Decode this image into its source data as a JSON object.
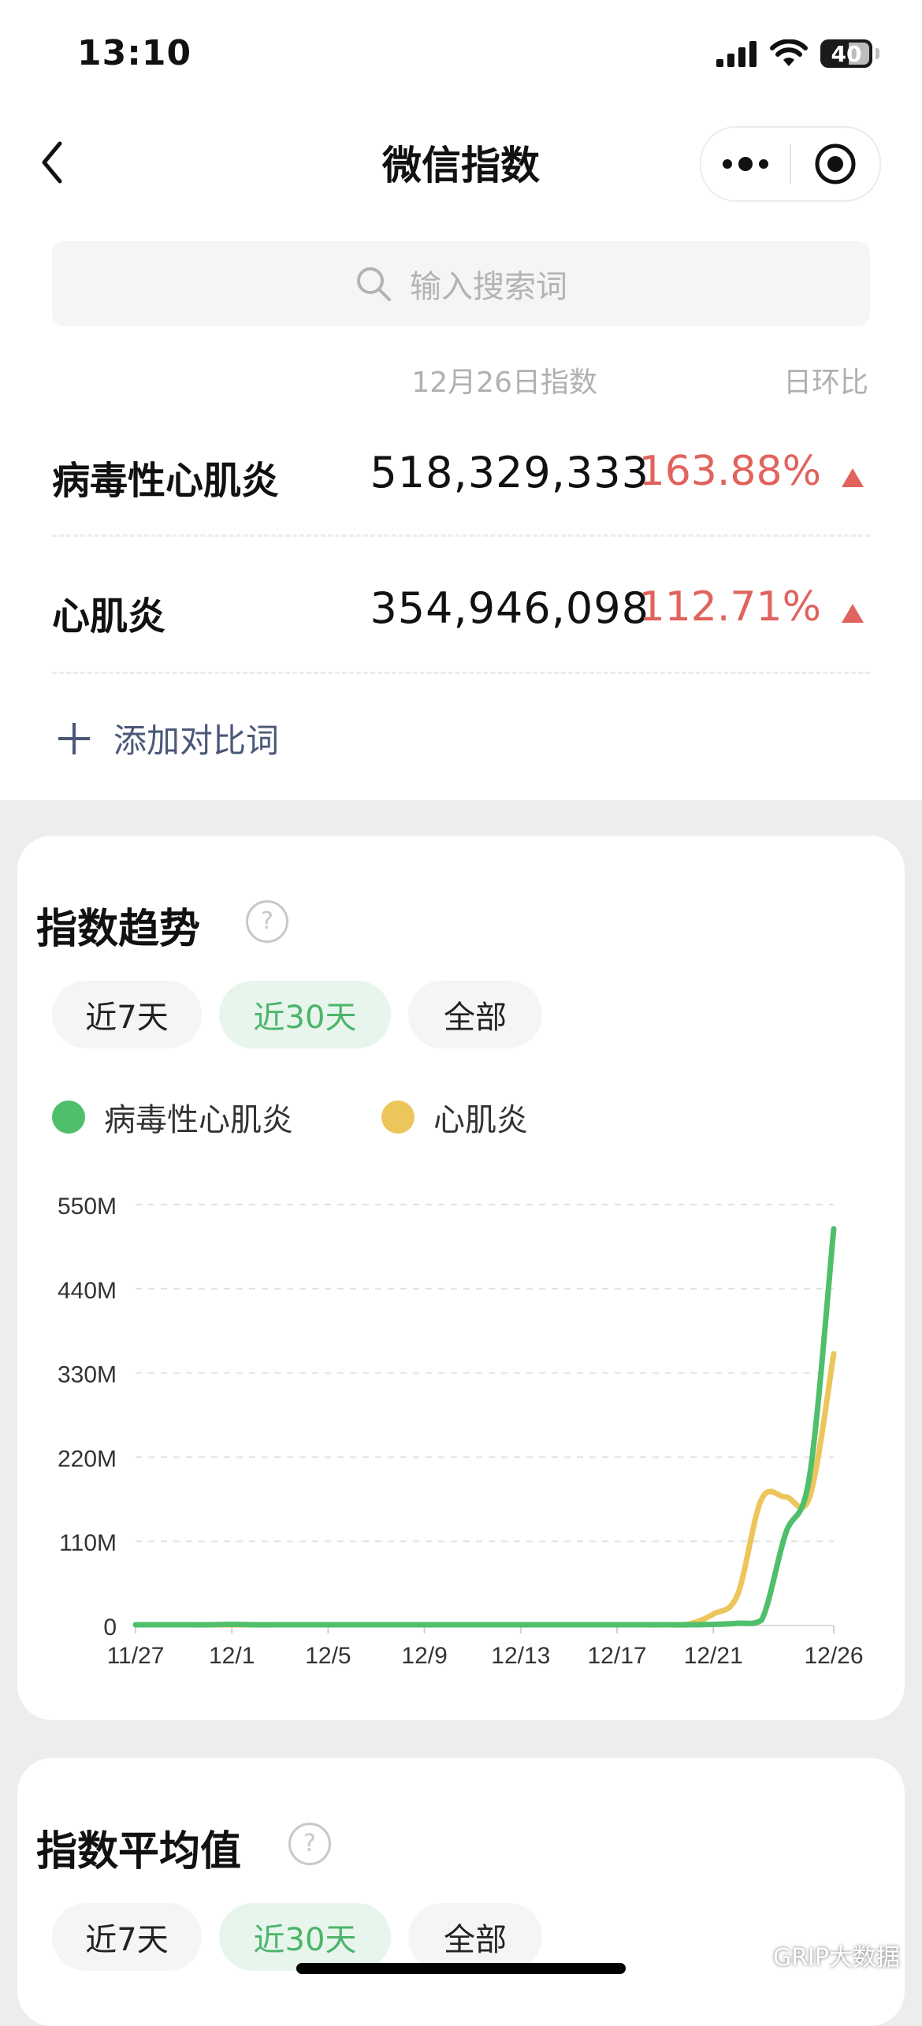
{
  "status": {
    "time": "13:10",
    "battery": "40"
  },
  "nav": {
    "title": "微信指数"
  },
  "search": {
    "placeholder": "输入搜索词"
  },
  "table": {
    "date_header": "12月26日指数",
    "ratio_header": "日环比",
    "rows": [
      {
        "term": "病毒性心肌炎",
        "value": "518,329,333",
        "change": "163.88%"
      },
      {
        "term": "心肌炎",
        "value": "354,946,098",
        "change": "112.71%"
      }
    ],
    "add_label": "添加对比词"
  },
  "trend": {
    "title": "指数趋势",
    "ranges": [
      "近7天",
      "近30天",
      "全部"
    ],
    "selected_range": "近30天"
  },
  "average": {
    "title": "指数平均值",
    "ranges": [
      "近7天",
      "近30天",
      "全部"
    ],
    "selected_range": "近30天"
  },
  "watermark": "GRIP大数据",
  "colors": {
    "green": "#4fbf6b",
    "yellow": "#ecc55b",
    "red": "#e0635d",
    "active_pill_bg": "#e8f5ec"
  },
  "chart_data": {
    "type": "line",
    "x": [
      "11/27",
      "11/28",
      "11/29",
      "11/30",
      "12/1",
      "12/2",
      "12/3",
      "12/4",
      "12/5",
      "12/6",
      "12/7",
      "12/8",
      "12/9",
      "12/10",
      "12/11",
      "12/12",
      "12/13",
      "12/14",
      "12/15",
      "12/16",
      "12/17",
      "12/18",
      "12/19",
      "12/20",
      "12/21",
      "12/22",
      "12/23",
      "12/24",
      "12/25",
      "12/26"
    ],
    "x_ticks": [
      "11/27",
      "12/1",
      "12/5",
      "12/9",
      "12/13",
      "12/17",
      "12/21",
      "12/26"
    ],
    "y_ticks": [
      "0",
      "110M",
      "220M",
      "330M",
      "440M",
      "550M"
    ],
    "ylim": [
      0,
      550000000
    ],
    "grid": true,
    "legend_position": "top",
    "series": [
      {
        "name": "病毒性心肌炎",
        "color": "#4fbf6b",
        "values": [
          1000000,
          1000000,
          1000000,
          1000000,
          1500000,
          1000000,
          1000000,
          1000000,
          1000000,
          1000000,
          1000000,
          1000000,
          1000000,
          1000000,
          1000000,
          1000000,
          1000000,
          1000000,
          1000000,
          1000000,
          1000000,
          1000000,
          1000000,
          1000000,
          1500000,
          3000000,
          7000000,
          120000000,
          196000000,
          518329333
        ]
      },
      {
        "name": "心肌炎",
        "color": "#ecc55b",
        "values": [
          1000000,
          1000000,
          1000000,
          1000000,
          1000000,
          1000000,
          1000000,
          1000000,
          1000000,
          1000000,
          1000000,
          1000000,
          1000000,
          1000000,
          1000000,
          1000000,
          1000000,
          1000000,
          1000000,
          1000000,
          1000000,
          1000000,
          1000000,
          2000000,
          15000000,
          40000000,
          165000000,
          168000000,
          168000000,
          354946098
        ]
      }
    ]
  }
}
